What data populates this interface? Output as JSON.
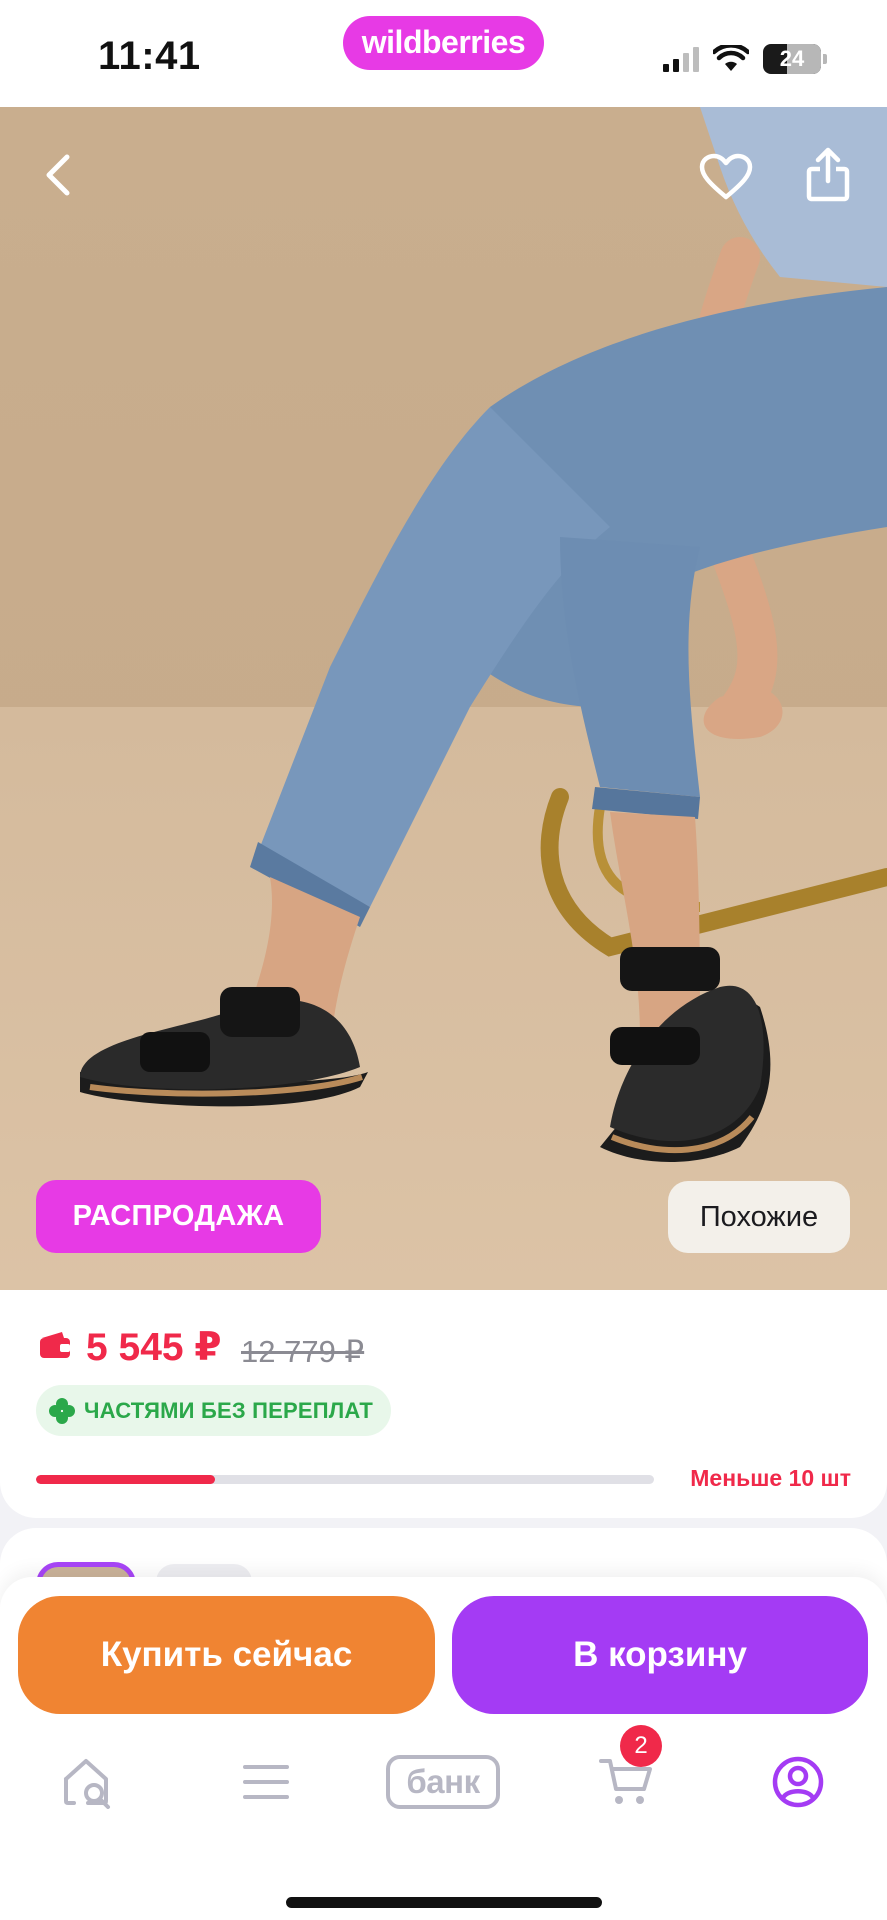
{
  "status_bar": {
    "time": "11:41",
    "app_pill": "wildberries",
    "battery": "24"
  },
  "hero": {
    "sale_badge": "РАСПРОДАЖА",
    "similar_button": "Похожие"
  },
  "price": {
    "current": "5 545 ₽",
    "old": "12 779 ₽",
    "installments": "ЧАСТЯМИ БЕЗ ПЕРЕПЛАТ",
    "stock_label": "Меньше 10 шт",
    "stock_level_fraction": 0.29
  },
  "actions": {
    "buy_now": "Купить сейчас",
    "add_to_cart": "В корзину"
  },
  "tabbar": {
    "bank_label": "банк",
    "cart_count": "2"
  },
  "colors": {
    "brand": "#e73ae5",
    "sale": "#e73ae5",
    "price": "#f0294a",
    "buy_now": "#f08432",
    "add_to_cart": "#a43bf4",
    "active_tab": "#a43bf4",
    "installments": "#2ba84a"
  },
  "icons": {
    "back": "chevron-left-icon",
    "favorite": "heart-icon",
    "share": "share-icon",
    "wallet": "wallet-icon",
    "installments": "clover-icon",
    "home": "home-search-icon",
    "catalog": "menu-icon",
    "cart": "cart-icon",
    "profile": "profile-icon"
  }
}
